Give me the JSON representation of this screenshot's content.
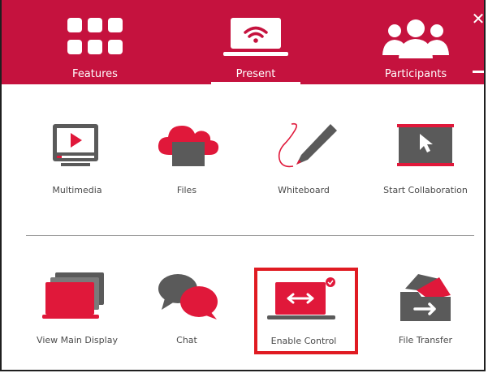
{
  "header": {
    "tabs": [
      {
        "label": "Features",
        "icon": "grid-icon"
      },
      {
        "label": "Present",
        "icon": "wifi-laptop-icon",
        "active": true
      },
      {
        "label": "Participants",
        "icon": "people-icon"
      }
    ],
    "close_glyph": "✕"
  },
  "tools_row1": [
    {
      "label": "Multimedia",
      "icon": "multimedia-icon"
    },
    {
      "label": "Files",
      "icon": "cloud-files-icon"
    },
    {
      "label": "Whiteboard",
      "icon": "whiteboard-pen-icon"
    },
    {
      "label": "Start Collaboration",
      "icon": "collaboration-board-icon"
    }
  ],
  "tools_row2": [
    {
      "label": "View Main Display",
      "icon": "main-display-icon"
    },
    {
      "label": "Chat",
      "icon": "chat-bubbles-icon"
    },
    {
      "label": "Enable Control",
      "icon": "enable-control-icon",
      "highlighted": true
    },
    {
      "label": "File Transfer",
      "icon": "file-transfer-icon"
    }
  ],
  "colors": {
    "brand_red": "#c5123e",
    "icon_red": "#e0183a",
    "icon_gray": "#5a5a5a",
    "highlight": "#e01b22"
  }
}
